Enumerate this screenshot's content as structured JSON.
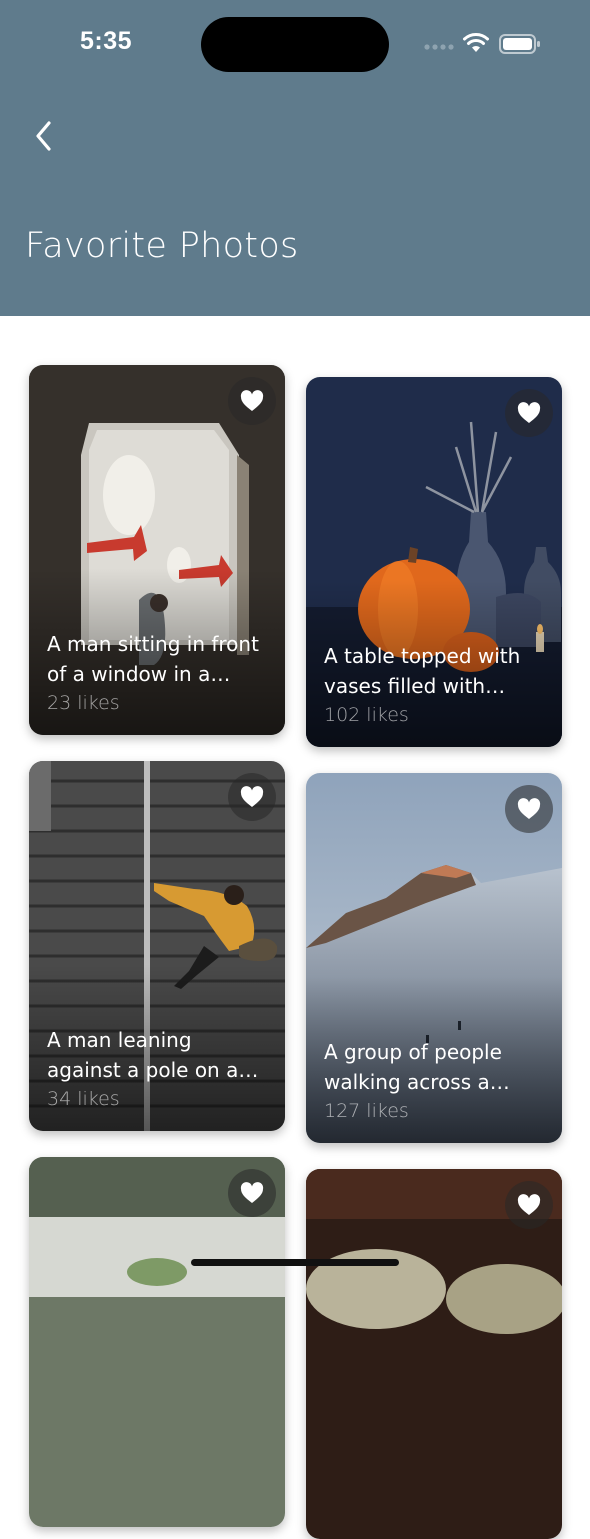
{
  "status_bar": {
    "time": "5:35"
  },
  "header": {
    "title": "Favorite Photos",
    "back_icon": "chevron-left-icon"
  },
  "colors": {
    "header_bg": "#5f7b8c",
    "background": "#ffffff"
  },
  "photos": [
    {
      "caption": "A man sitting in front of a window in a building",
      "likes": "23 likes",
      "favorite": true
    },
    {
      "caption": "A table topped with vases filled with pumpkins",
      "likes": "102 likes",
      "favorite": true
    },
    {
      "caption": "A man leaning against a pole on a staircase",
      "likes": "34 likes",
      "favorite": true
    },
    {
      "caption": "A group of people walking across a snowy mountain",
      "likes": "127 likes",
      "favorite": true
    },
    {
      "caption": "",
      "likes": "",
      "favorite": true
    },
    {
      "caption": "",
      "likes": "",
      "favorite": true
    }
  ]
}
